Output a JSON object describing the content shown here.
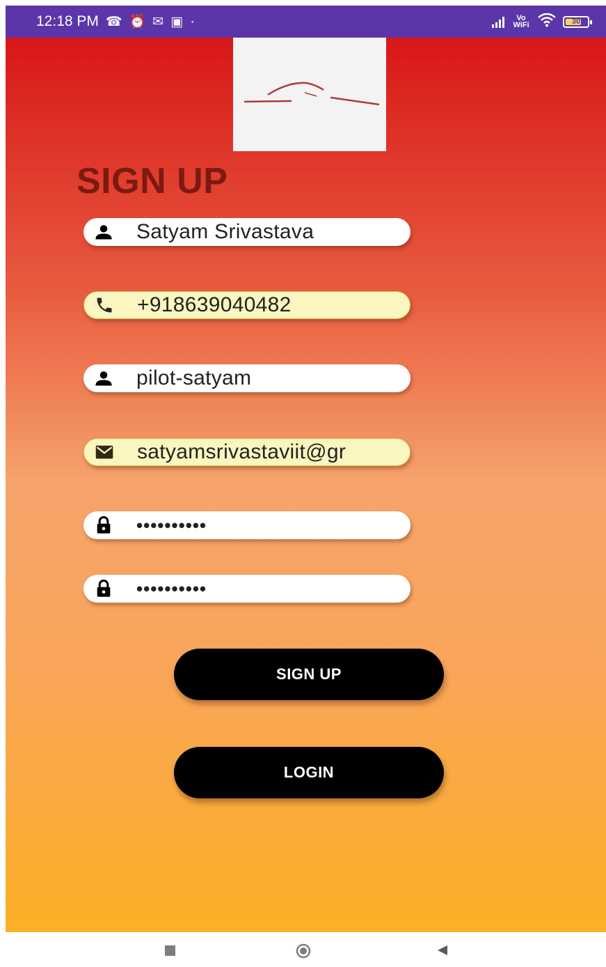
{
  "status_bar": {
    "time": "12:18 PM",
    "notification_icons": [
      "missed-call-icon",
      "alarm-icon",
      "gmail-icon",
      "app-icon"
    ],
    "dot": "·",
    "vowifi": "Vo WiFi",
    "battery_level": "30"
  },
  "header": {
    "title": "SIGN UP"
  },
  "form": {
    "fields": [
      {
        "icon": "person-icon",
        "value": "Satyam Srivastava",
        "autofill": false
      },
      {
        "icon": "phone-icon",
        "value": "+918639040482",
        "autofill": true
      },
      {
        "icon": "person-icon",
        "value": "pilot-satyam",
        "autofill": false
      },
      {
        "icon": "email-icon",
        "value": "satyamsrivastaviit@gr",
        "autofill": true
      },
      {
        "icon": "lock-icon",
        "value": "••••••••••",
        "autofill": false
      },
      {
        "icon": "lock-icon",
        "value": "••••••••••",
        "autofill": false
      }
    ],
    "signup_label": "SIGN UP",
    "login_label": "LOGIN"
  },
  "colors": {
    "status_bar": "#5a36a8",
    "gradient_top": "#d81718",
    "gradient_bottom": "#fbb024",
    "title": "#7b1a10",
    "button": "#000000"
  },
  "navigation": {
    "buttons": [
      "recents-square-icon",
      "home-circle-icon",
      "back-triangle-icon"
    ]
  }
}
